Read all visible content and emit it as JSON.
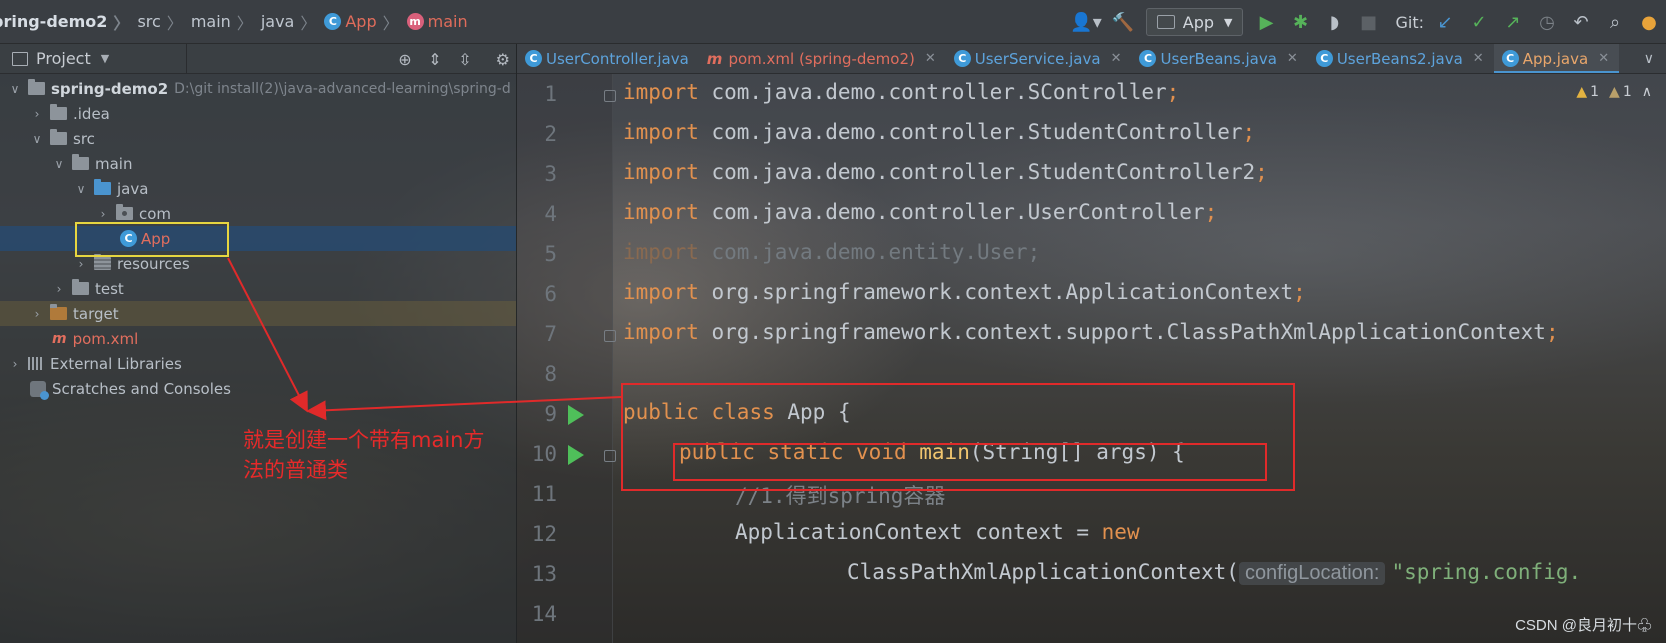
{
  "breadcrumb": {
    "items": [
      {
        "label": "pring-demo2",
        "style": "strong"
      },
      {
        "label": "src",
        "style": "normal"
      },
      {
        "label": "main",
        "style": "normal"
      },
      {
        "label": "java",
        "style": "normal"
      },
      {
        "label": "App",
        "style": "class",
        "icon": "class-icon"
      },
      {
        "label": "main",
        "style": "method",
        "icon": "method-icon"
      }
    ]
  },
  "toolbar": {
    "run_config": "App",
    "git_label": "Git:"
  },
  "project": {
    "title": "Project",
    "tree": [
      {
        "label": "spring-demo2",
        "path": "D:\\git install(2)\\java-advanced-learning\\spring-d",
        "level": 0,
        "arrow": "down",
        "icon": "module-folder-icon"
      },
      {
        "label": ".idea",
        "level": 1,
        "arrow": "right",
        "icon": "folder-icon"
      },
      {
        "label": "src",
        "level": 1,
        "arrow": "down",
        "icon": "folder-icon"
      },
      {
        "label": "main",
        "level": 2,
        "arrow": "down",
        "icon": "folder-icon"
      },
      {
        "label": "java",
        "level": 3,
        "arrow": "down",
        "icon": "source-folder-icon"
      },
      {
        "label": "com",
        "level": 4,
        "arrow": "right",
        "icon": "package-icon"
      },
      {
        "label": "App",
        "level": 5,
        "arrow": "none",
        "icon": "class-icon",
        "selected": true
      },
      {
        "label": "resources",
        "level": 3,
        "arrow": "right",
        "icon": "resources-folder-icon"
      },
      {
        "label": "test",
        "level": 2,
        "arrow": "right",
        "icon": "folder-icon"
      },
      {
        "label": "target",
        "level": 1,
        "arrow": "right",
        "icon": "folder-icon"
      },
      {
        "label": "pom.xml",
        "level": 1,
        "arrow": "none",
        "icon": "maven-icon"
      },
      {
        "label": "External Libraries",
        "level": 0,
        "arrow": "right",
        "icon": "libraries-icon"
      },
      {
        "label": "Scratches and Consoles",
        "level": 0,
        "arrow": "none",
        "icon": "scratches-icon"
      }
    ]
  },
  "tabs": [
    {
      "label": "UserController.java",
      "icon": "class-icon"
    },
    {
      "label": "pom.xml (spring-demo2)",
      "icon": "maven-icon"
    },
    {
      "label": "UserService.java",
      "icon": "class-icon"
    },
    {
      "label": "UserBeans.java",
      "icon": "class-icon"
    },
    {
      "label": "UserBeans2.java",
      "icon": "class-icon"
    },
    {
      "label": "App.java",
      "icon": "class-icon",
      "active": true
    }
  ],
  "editor": {
    "inspections": {
      "warnings": "1",
      "weak_warnings": "1"
    },
    "line_numbers": [
      "1",
      "2",
      "3",
      "4",
      "5",
      "6",
      "7",
      "8",
      "9",
      "10",
      "11",
      "12",
      "13",
      "14"
    ],
    "lines": [
      {
        "kw": "import",
        "rest": " com.java.demo.controller.SController",
        "semi": ";"
      },
      {
        "kw": "import",
        "rest": " com.java.demo.controller.StudentController",
        "semi": ";"
      },
      {
        "kw": "import",
        "rest": " com.java.demo.controller.StudentController2",
        "semi": ";"
      },
      {
        "kw": "import",
        "rest": " com.java.demo.controller.UserController",
        "semi": ";"
      },
      {
        "kw": "import",
        "rest": " com.java.demo.entity.User",
        "semi": ";",
        "faded": true
      },
      {
        "kw": "import",
        "rest": " org.springframework.context.ApplicationContext",
        "semi": ";"
      },
      {
        "kw": "import",
        "rest": " org.springframework.context.support.ClassPathXmlApplicationContext",
        "semi": ";"
      },
      {
        "text": ""
      },
      {
        "kw1": "public",
        "kw2": "class",
        "rest": " App {"
      },
      {
        "kw1": "public",
        "kw2": "static",
        "kw3": "void",
        "fn": "main",
        "rest": "(String[] args) {"
      },
      {
        "comment": "//1.得到spring容器"
      },
      {
        "rest": "ApplicationContext context = ",
        "kw": "new"
      },
      {
        "rest": "ClassPathXmlApplicationContext(",
        "hint": "configLocation:",
        "str": "\"spring.config."
      },
      {
        "text": ""
      }
    ]
  },
  "annotation": {
    "note": "就是创建一个带有main方法的普通类"
  },
  "watermark": "CSDN @良月初十♧"
}
